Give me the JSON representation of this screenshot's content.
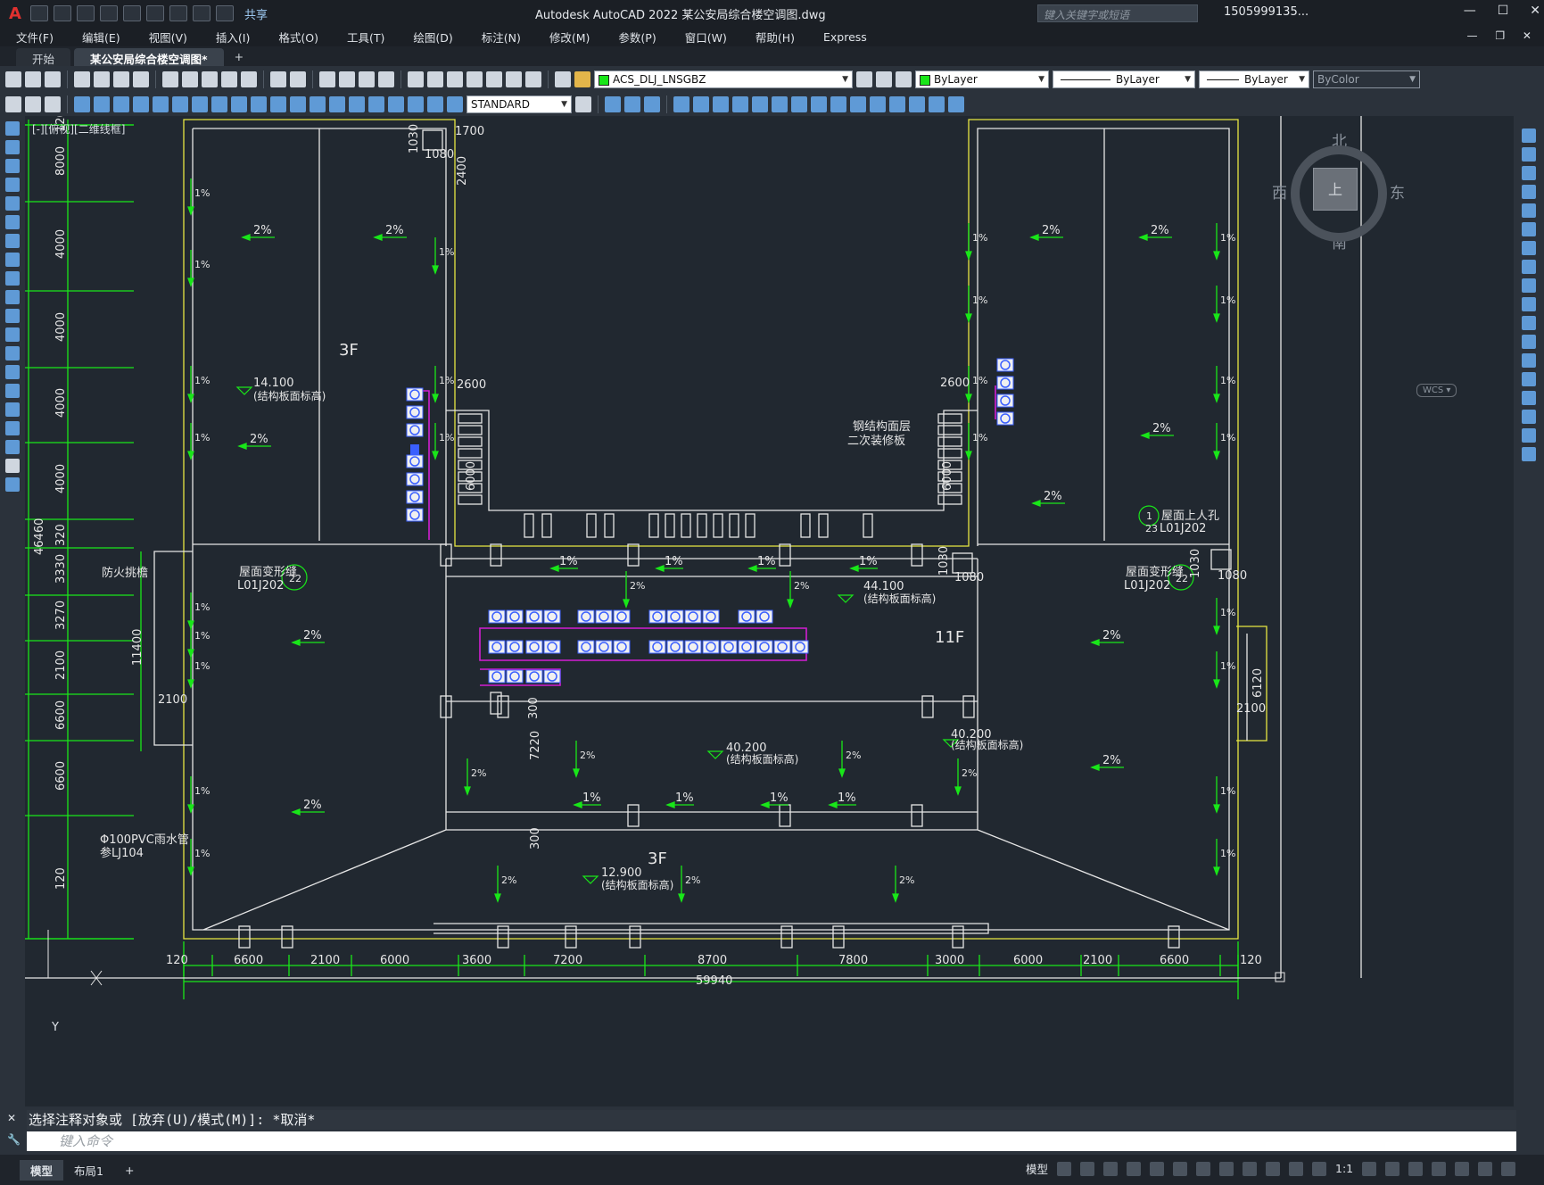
{
  "app": {
    "title": "Autodesk AutoCAD 2022    某公安局综合楼空调图.dwg",
    "share_label": "共享",
    "search_placeholder": "键入关键字或短语",
    "user": "1505999135...",
    "logo": "A"
  },
  "menu": [
    "文件(F)",
    "编辑(E)",
    "视图(V)",
    "插入(I)",
    "格式(O)",
    "工具(T)",
    "绘图(D)",
    "标注(N)",
    "修改(M)",
    "参数(P)",
    "窗口(W)",
    "帮助(H)",
    "Express"
  ],
  "tabs": [
    {
      "label": "开始"
    },
    {
      "label": "某公安局综合楼空调图*"
    }
  ],
  "toolbar": {
    "layer": "ACS_DLJ_LNSGBZ",
    "color": "ByLayer",
    "linetype": "ByLayer",
    "lineweight": "ByLayer",
    "plotstyle": "ByColor",
    "textstyle": "STANDARD",
    "layer_color": "#19e619"
  },
  "view": {
    "label": "[-][俯视][二维线框]",
    "compass": {
      "n": "北",
      "s": "南",
      "e": "东",
      "w": "西",
      "top": "上"
    },
    "wcs": "WCS ▾",
    "axis_y": "Y"
  },
  "drawing": {
    "floors": [
      "3F",
      "11F",
      "3F"
    ],
    "elev_1": "14.100",
    "elev_2": "44.100",
    "elev_3": "40.200",
    "elev_4": "40.200",
    "elev_5": "12.900",
    "elev_note": "(结构板面标高)",
    "slope_2": "2%",
    "slope_1": "1%",
    "label_fire": "防火挑檐",
    "label_roof": "屋面变形缝",
    "label_roof_ref": "L01J202",
    "label_roof_ref_num": "22",
    "label_hatch": "屋面上人孔",
    "label_hatch_ref": "L01J202",
    "label_hatch_ref_num": "23",
    "label_hatch_num": "1",
    "label_steel_1": "钢结构面层",
    "label_steel_2": "二次装修板",
    "label_pipe_1": "Φ100PVC雨水管",
    "label_pipe_2": "参LJ104",
    "dims_left": [
      "120",
      "8000",
      "4000",
      "4000",
      "4000",
      "4000",
      "320",
      "3330",
      "3270",
      "2100",
      "6600",
      "6600",
      "120"
    ],
    "dim_total_left": "46460",
    "dim_11400": "11400",
    "dim_2100": "2100",
    "dims_bottom": [
      "120",
      "6600",
      "2100",
      "6000",
      "3600",
      "7200",
      "8700",
      "7800",
      "3000",
      "6000",
      "2100",
      "6600",
      "120"
    ],
    "dim_total_bottom": "59940",
    "dim_1700": "1700",
    "dim_1030": "1030",
    "dim_1080": "1080",
    "dim_2400": "2400",
    "dim_2600": "2600",
    "dim_6000": "6000",
    "dim_300": "300",
    "dim_7220": "7220",
    "dim_6120": "6120"
  },
  "command": {
    "history": "选择注释对象或 [放弃(U)/模式(M)]: *取消*",
    "placeholder": "键入命令"
  },
  "status": {
    "model_tab": "模型",
    "layout_tab": "布局1",
    "model_label": "模型",
    "scale": "1:1"
  },
  "colors": {
    "bg": "#212830",
    "wall": "#e8e842",
    "dim": "#19e619",
    "white": "#e6e6e6",
    "magenta": "#d21ed2",
    "unit_blue": "#3a5fff"
  }
}
